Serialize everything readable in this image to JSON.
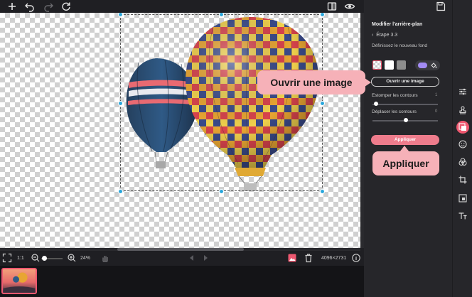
{
  "toolbar": {
    "icons": [
      "plus-icon",
      "undo-icon",
      "redo-icon",
      "reset-icon",
      "compare-icon",
      "eye-icon",
      "save-icon"
    ]
  },
  "canvas": {
    "image_dimensions": "4096×2731"
  },
  "bottom_bar": {
    "fit_label": "1:1",
    "zoom": "24%"
  },
  "panel": {
    "title": "Modifier l'arrière-plan",
    "step": "Étape 3.3",
    "step_subtitle": "Définissez le nouveau fond",
    "swatches": [
      "transparent",
      "#ffffff",
      "#8d8d8d"
    ],
    "picker_color": "#a48cf5",
    "open_image_label": "Ouvrir une image",
    "slider_blur": {
      "label": "Estomper les contours",
      "value": "1",
      "level": 0.05
    },
    "slider_shift": {
      "label": "Déplacer les contours",
      "value": "0",
      "level": 0.5
    },
    "apply_label": "Appliquer"
  },
  "callouts": {
    "open_image": "Ouvrir une image",
    "apply": "Appliquer"
  },
  "colors": {
    "accent": "#ee5870",
    "handle": "#2aa7dc",
    "callout": "#f6b1b8"
  }
}
